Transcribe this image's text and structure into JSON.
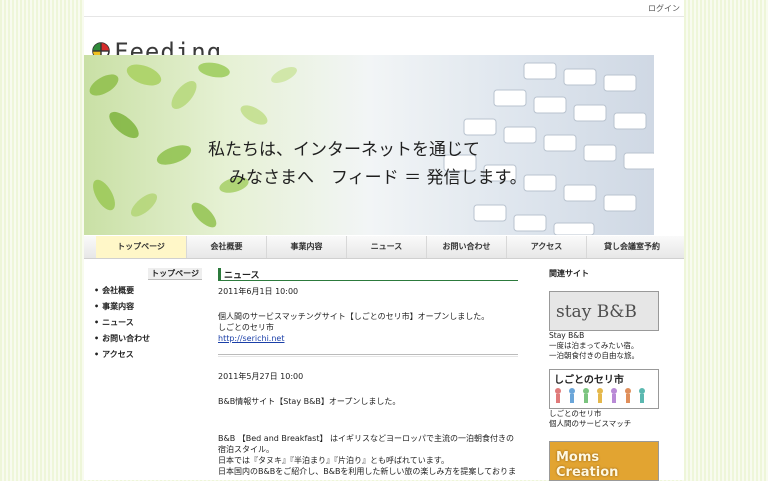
{
  "header": {
    "login": "ログイン",
    "logo_text": "Feeding"
  },
  "hero": {
    "line1": "私たちは、インターネットを通じて",
    "line2": "みなさまへ　フィード ＝ 発信します。"
  },
  "nav": {
    "items": [
      {
        "label": "トップページ"
      },
      {
        "label": "会社概要"
      },
      {
        "label": "事業内容"
      },
      {
        "label": "ニュース"
      },
      {
        "label": "お問い合わせ"
      },
      {
        "label": "アクセス"
      },
      {
        "label": "貸し会議室予約"
      }
    ]
  },
  "sidebar": {
    "heading": "トップページ",
    "items": [
      {
        "label": "会社概要"
      },
      {
        "label": "事業内容"
      },
      {
        "label": "ニュース"
      },
      {
        "label": "お問い合わせ"
      },
      {
        "label": "アクセス"
      }
    ]
  },
  "news": {
    "title": "ニュース",
    "entries": [
      {
        "date": "2011年6月1日  10:00",
        "body1": "個人間のサービスマッチングサイト【しごとのセリ市】オープンしました。",
        "body2": "しごとのセリ市",
        "link": "http://serichi.net"
      },
      {
        "date": "2011年5月27日 10:00",
        "body1": "B&B情報サイト【Stay B&B】オープンしました。",
        "body2": "B&B 【Bed and Breakfast】 はイギリスなどヨーロッパで主流の一泊朝食付きの宿泊スタイル。",
        "body3": "日本では『タヌキ』『半泊まり』『片泊り』とも呼ばれています。",
        "body4": "日本国内のB&Bをご紹介し、B&Bを利用した新しい旅の楽しみ方を提案しておりま"
      }
    ]
  },
  "related": {
    "heading": "関連サイト",
    "sites": [
      {
        "banner": "stay B&B",
        "name": "Stay B&B",
        "desc1": "一度は泊まってみたい宿。",
        "desc2": "一泊朝食付きの自由な旅。"
      },
      {
        "banner": "しごとのセリ市",
        "name": "しごとのセリ市",
        "desc1": "個人間のサービスマッチ"
      },
      {
        "banner": "Moms Creation"
      }
    ]
  }
}
